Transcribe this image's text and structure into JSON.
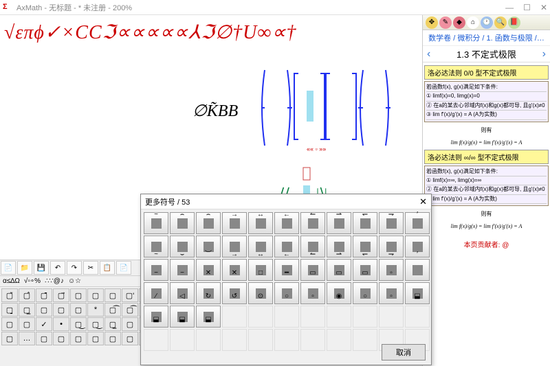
{
  "window": {
    "app": "AxMath",
    "title": "AxMath - 无标题 - * 未注册 - 200%",
    "min": "—",
    "max": "☐",
    "close": "✕"
  },
  "formula": {
    "line1": "√επϕ✓×CCℑ∝∝∝∝∝⅄ℑ∅†U∞∝†",
    "line2_a": "∅K̃BB",
    "lower_angles": "⟨⟨ ▯ |⟩|"
  },
  "sidebar": {
    "breadcrumb": "数学卷 / 微积分 / 1. 函数与极限 /…",
    "section": "1.3 不定式极限",
    "rule1": "洛必达法则 0/0 型不定式极限",
    "rule1_body": [
      "若函数f(x), g(x)满足如下条件:",
      "① limf(x)=0, limg(x)=0",
      "② 在a的某去心邻域内f(x)和g(x)都可导, 且g'(x)≠0",
      "③ lim f'(x)/g'(x) = A (A为实数)"
    ],
    "rule1_then": "则有",
    "rule1_eq": "lim f(x)/g(x) = lim f'(x)/g'(x) = A",
    "rule2": "洛必达法则 ∞/∞ 型不定式极限",
    "rule2_body": [
      "若函数f(x), g(x)满足如下条件:",
      "① limf(x)=∞, limg(x)=∞",
      "② 在a的某去心邻域内f(x)和g(x)都可导, 且g'(x)≠0",
      "③ lim f'(x)/g'(x) = A (A为实数)"
    ],
    "rule2_then": "则有",
    "rule2_eq": "lim f(x)/g(x) = lim f'(x)/g'(x) = A",
    "contrib": "本页贡献者: @"
  },
  "dialog": {
    "title": "更多符号 / 53",
    "cancel": "取消"
  },
  "dialog_overlays": [
    "~",
    "⌢",
    "⌢",
    "→",
    "↔",
    "←",
    "↼",
    "⇀",
    "↽",
    "⇁",
    "′",
    "~",
    "⌣",
    "︶",
    "→",
    "↔",
    "←",
    "↼",
    "⇀",
    "↽",
    "⇁",
    "′",
    "−",
    "−",
    "✕",
    "✕",
    "□",
    "━",
    "▭",
    "▭",
    "▭",
    "▫",
    "",
    "∕",
    "◁",
    "↻",
    "↺",
    "⊙",
    "○",
    "▫",
    "◉",
    "○",
    "▫",
    "⬓",
    "⬓",
    "⬓",
    "⬓"
  ],
  "palette_top_rows": [
    "▢̃",
    "▢̂",
    "▢̄",
    "▢⃗",
    "▢",
    "▢",
    "▢",
    "▢'",
    "▢̌",
    "▢̬",
    "▢̱",
    "▢̲",
    "▢",
    "▢",
    "▢",
    "*",
    "▢͡",
    "▢͡",
    "▢̄",
    "▢",
    "▢",
    "▢",
    "✓",
    "•",
    "▢͜",
    "▢͜",
    "▢̲",
    "▢",
    "▢",
    "▢",
    "▢",
    "…"
  ]
}
